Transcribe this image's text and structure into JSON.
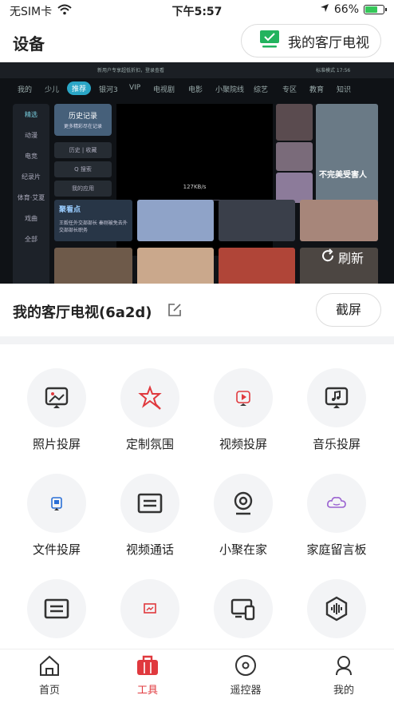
{
  "status": {
    "carrier": "无SIM卡",
    "time": "下午5:57",
    "battery_pct": "66%",
    "battery_level": 0.66
  },
  "header": {
    "title": "设备",
    "current_tv_label": "我的客厅电视"
  },
  "preview": {
    "tv_nav": [
      "我的",
      "少儿",
      "推荐",
      "银河3",
      "VIP",
      "电视剧",
      "电影",
      "小聚院线",
      "综艺",
      "专区",
      "教育",
      "知识"
    ],
    "tv_nav_active": "推荐",
    "tv_side": [
      "精选",
      "动漫",
      "电竞",
      "纪录片",
      "体育·艾夏",
      "戏曲",
      "全部"
    ],
    "history_title": "历史记录",
    "history_sub": "更多精彩尽在记录",
    "boxes": [
      "历史 | 收藏",
      "Q 搜索",
      "我的应用"
    ],
    "speed": "127KB/s",
    "news_title": "聚看点",
    "news_text": "王毅任外交部部长 秦刚被免去外交部部长职务",
    "drama_title": "不完美受害人",
    "tv_top_left": "新用户专享超低折扣，登录查看",
    "tv_top_right": "标准模式  17:56",
    "refresh_label": "刷新"
  },
  "device": {
    "name": "我的客厅电视(6a2d)",
    "screenshot_label": "截屏"
  },
  "tools": [
    {
      "label": "照片投屏",
      "icon": "photo-cast-icon"
    },
    {
      "label": "定制氛围",
      "icon": "ambience-icon"
    },
    {
      "label": "视频投屏",
      "icon": "video-cast-icon"
    },
    {
      "label": "音乐投屏",
      "icon": "music-cast-icon"
    },
    {
      "label": "文件投屏",
      "icon": "file-cast-icon"
    },
    {
      "label": "视频通话",
      "icon": "video-call-icon"
    },
    {
      "label": "小聚在家",
      "icon": "camera-icon"
    },
    {
      "label": "家庭留言板",
      "icon": "message-board-icon"
    },
    {
      "label": "",
      "icon": "subtitle-icon"
    },
    {
      "label": "",
      "icon": "screen-crop-icon"
    },
    {
      "label": "",
      "icon": "multi-screen-icon"
    },
    {
      "label": "",
      "icon": "voice-icon"
    }
  ],
  "tabs": [
    {
      "label": "首页",
      "icon": "home-icon"
    },
    {
      "label": "工具",
      "icon": "toolbox-icon"
    },
    {
      "label": "遥控器",
      "icon": "remote-icon"
    },
    {
      "label": "我的",
      "icon": "profile-icon"
    }
  ],
  "colors": {
    "accent": "#e0393e",
    "green": "#22b35e",
    "teal": "#2aa6c6"
  }
}
